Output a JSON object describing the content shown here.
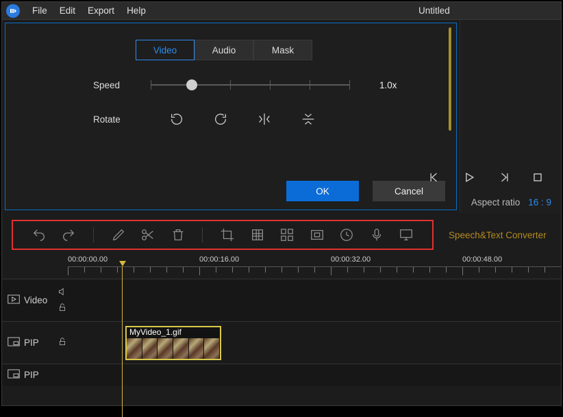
{
  "app": {
    "title": "Untitled"
  },
  "menu": {
    "items": [
      "File",
      "Edit",
      "Export",
      "Help"
    ]
  },
  "tabs": {
    "video": "Video",
    "audio": "Audio",
    "mask": "Mask"
  },
  "properties": {
    "speed_label": "Speed",
    "speed_value": "1.0x",
    "rotate_label": "Rotate",
    "ok_label": "OK",
    "cancel_label": "Cancel"
  },
  "right": {
    "aspect_label": "Aspect ratio",
    "aspect_value": "16 : 9"
  },
  "toolbar": {
    "speech_link": "Speech&Text Converter"
  },
  "ruler": {
    "t0": "00:00:00.00",
    "t1": "00:00:16.00",
    "t2": "00:00:32.00",
    "t3": "00:00:48.00"
  },
  "tracks": {
    "video": "Video",
    "pip1": "PIP",
    "pip2": "PIP"
  },
  "clip": {
    "label": "MyVideo_1.gif"
  }
}
